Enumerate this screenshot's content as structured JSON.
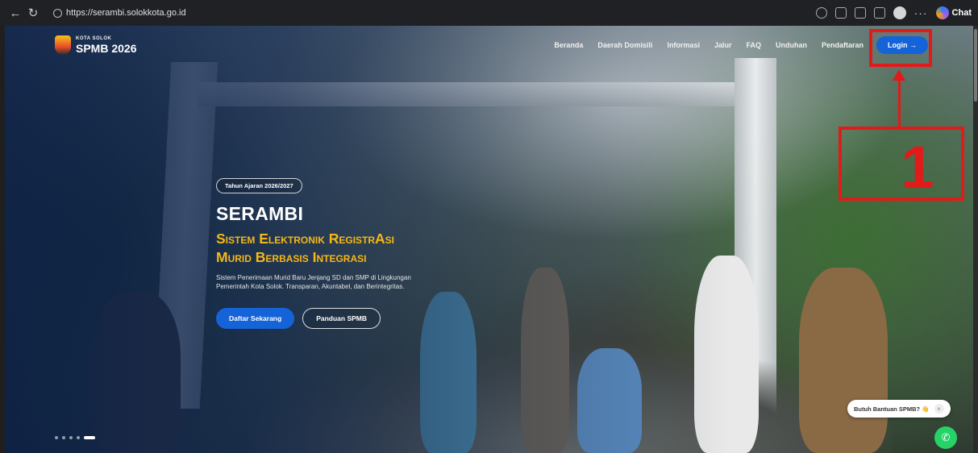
{
  "browser": {
    "url": "https://serambi.solokkota.go.id",
    "chat_label": "Chat"
  },
  "site": {
    "brand_small": "KOTA SOLOK",
    "brand_big": "SPMB 2026",
    "menu": [
      "Beranda",
      "Daerah Domisili",
      "Informasi",
      "Jalur",
      "FAQ",
      "Unduhan",
      "Pendaftaran"
    ],
    "login_label": "Login →"
  },
  "hero": {
    "pill": "Tahun Ajaran 2026/2027",
    "title": "SERAMBI",
    "subtitle_line1": "Sistem Elektronik RegistrAsi",
    "subtitle_line2": "Murid Berbasis Integrasi",
    "description": "Sistem Penerimaan Murid Baru Jenjang SD dan SMP di Lingkungan Pemerintah Kota Solok. Transparan, Akuntabel, dan Berintegritas.",
    "primary_button": "Daftar Sekarang",
    "secondary_button": "Panduan SPMB"
  },
  "help": {
    "bubble_text": "Butuh Bantuan SPMB? 👋",
    "close": "×"
  },
  "annotation": {
    "number": "1"
  },
  "colors": {
    "accent_blue": "#1463d8",
    "accent_yellow": "#f5b817",
    "annotation_red": "#e21a1a",
    "whatsapp_green": "#25d366"
  }
}
